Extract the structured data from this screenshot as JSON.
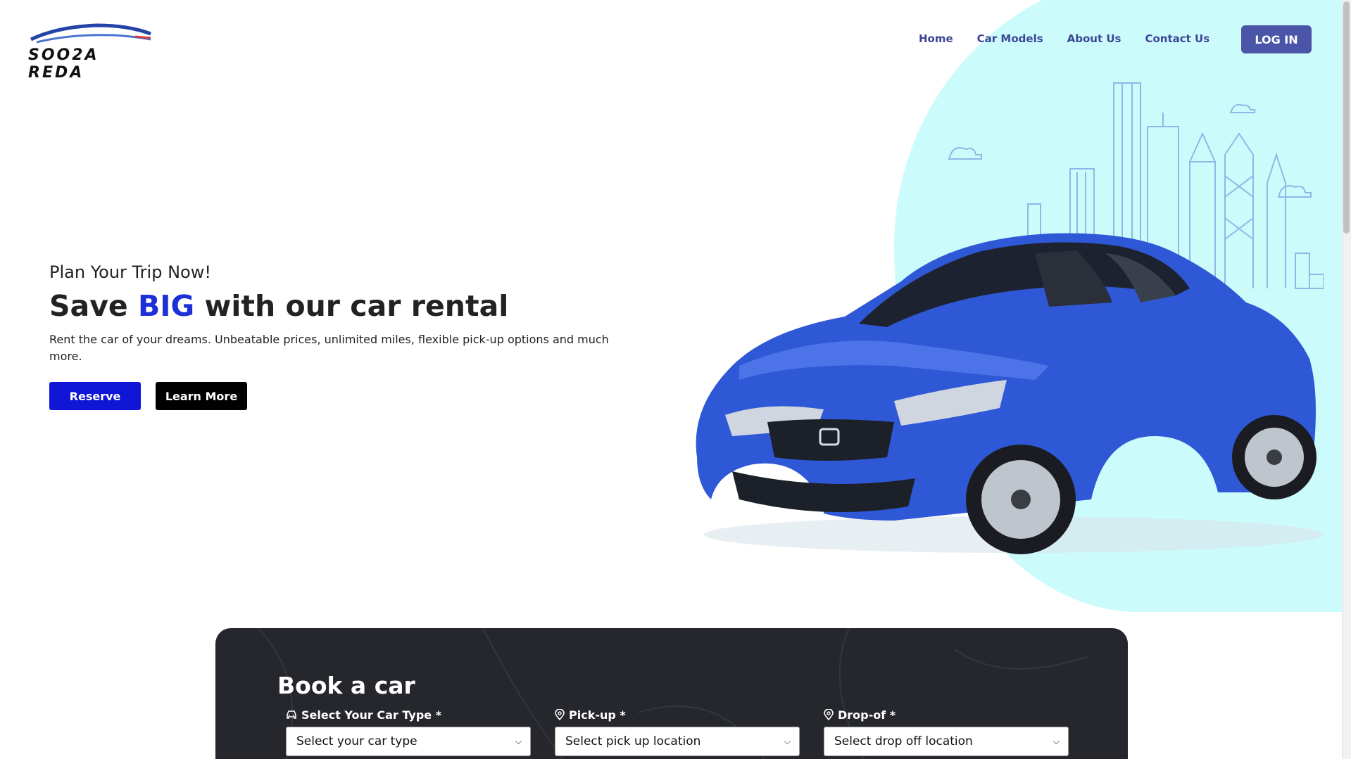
{
  "brand": {
    "name": "SOO2A REDA",
    "logo_icon": "car-swoosh-icon"
  },
  "nav": {
    "items": [
      {
        "label": "Home"
      },
      {
        "label": "Car Models"
      },
      {
        "label": "About Us"
      },
      {
        "label": "Contact Us"
      }
    ],
    "login_label": "LOG IN"
  },
  "hero": {
    "eyebrow": "Plan Your Trip Now!",
    "title_prefix": "Save ",
    "title_accent": "BIG",
    "title_suffix": " with our car rental",
    "description": "Rent the car of your dreams. Unbeatable prices, unlimited miles, flexible pick-up options and much more.",
    "reserve_label": "Reserve",
    "learn_more_label": "Learn More",
    "image": "blue-honda-coupe"
  },
  "booking": {
    "title": "Book a car",
    "fields": [
      {
        "label": "Select Your Car Type *",
        "icon": "car-icon",
        "value": "Select your car type"
      },
      {
        "label": "Pick-up *",
        "icon": "location-pin-icon",
        "value": "Select pick up location"
      },
      {
        "label": "Drop-of *",
        "icon": "location-pin-icon",
        "value": "Select drop off location"
      }
    ]
  },
  "colors": {
    "accent": "#1d2fd6",
    "nav_text": "#3d4696",
    "login_bg": "#4a55a8",
    "blob": "#ccfbfb",
    "booking_bg": "#25272d"
  }
}
